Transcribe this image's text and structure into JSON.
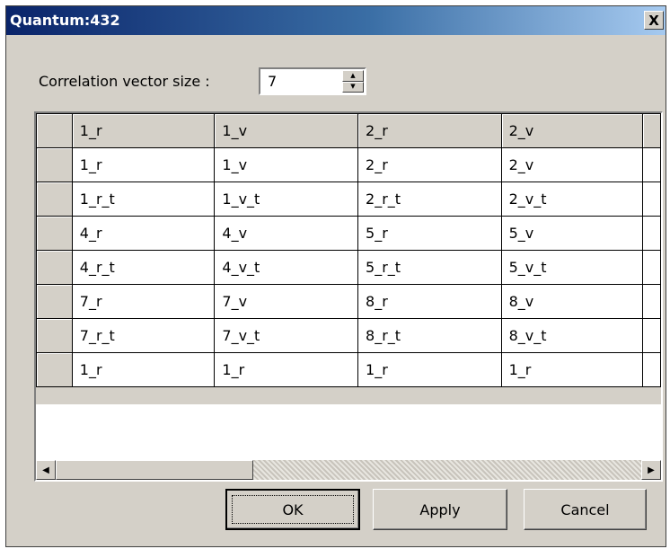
{
  "window": {
    "title": "Quantum:432",
    "close_label": "X"
  },
  "correlation": {
    "label": "Correlation vector size :",
    "value": "7"
  },
  "grid": {
    "columns": [
      "1_r",
      "1_v",
      "2_r",
      "2_v"
    ],
    "rows": [
      [
        "1_r",
        "1_v",
        "2_r",
        "2_v"
      ],
      [
        "1_r_t",
        "1_v_t",
        "2_r_t",
        "2_v_t"
      ],
      [
        "4_r",
        "4_v",
        "5_r",
        "5_v"
      ],
      [
        "4_r_t",
        "4_v_t",
        "5_r_t",
        "5_v_t"
      ],
      [
        "7_r",
        "7_v",
        "8_r",
        "8_v"
      ],
      [
        "7_r_t",
        "7_v_t",
        "8_r_t",
        "8_v_t"
      ],
      [
        "1_r",
        "1_r",
        "1_r",
        "1_r"
      ]
    ]
  },
  "buttons": {
    "ok": "OK",
    "apply": "Apply",
    "cancel": "Cancel"
  },
  "icons": {
    "close": "close-icon",
    "spin_up": "spin-up-icon",
    "spin_down": "spin-down-icon",
    "scroll_left": "scroll-left-icon",
    "scroll_right": "scroll-right-icon"
  },
  "colors": {
    "titlebar_start": "#0a246a",
    "titlebar_end": "#a6caf0",
    "face": "#d4d0c8"
  }
}
